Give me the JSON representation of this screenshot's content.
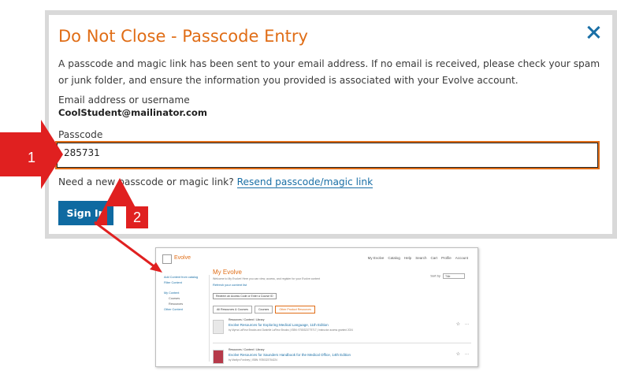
{
  "modal": {
    "title": "Do Not Close - Passcode Entry",
    "intro": "A passcode and magic link has been sent to your email address. If no email is received, please check your spam or junk folder, and ensure the information you provided is associated with your Evolve account.",
    "email_label": "Email address or username",
    "email_value": "CoolStudent@mailinator.com",
    "passcode_label": "Passcode",
    "passcode_value": "285731",
    "resend_prompt": "Need a new passcode or magic link?",
    "resend_link": "Resend passcode/magic link",
    "signin_label": "Sign In"
  },
  "callouts": {
    "one": "1",
    "two": "2"
  },
  "colors": {
    "accent": "#e06d16",
    "primary": "#0f6aa1",
    "callout": "#e02020"
  },
  "preview": {
    "logo": "Evolve",
    "topnav": [
      "My Evolve",
      "Catalog",
      "Help",
      "Search",
      "Cart",
      "Profile",
      "Account"
    ],
    "sidebar": [
      "Add Content from catalog",
      "Filter Content",
      "My Content",
      "Courses",
      "Resources",
      "Other Content"
    ],
    "title": "My Evolve",
    "subtitle": "Welcome to My Evolve! Here you can view, access, and register for your Evolve content",
    "refresh": "Refresh your content list",
    "redeem": "Redeem an Access Code or Enter a Course ID",
    "sort_label": "Sort by",
    "sort_value": "Title",
    "tabs": [
      "All Resources & Courses",
      "Courses",
      "Other Product Resources"
    ],
    "items": [
      {
        "category": "Resources / Content / Library",
        "name": "Evolve Resources for Exploring Medical Language, 11th Edition",
        "meta": "by Myrna LaFleur Brooks and Danielle LaFleur Brooks | ISBN: 9780323779717 | Instructor access granted 2024"
      },
      {
        "category": "Resources / Content / Library",
        "name": "Evolve Resources for Saunders Handbook for the Medical Office, 14th Edition",
        "meta": "by Marilyn Fordney | ISBN: 9780323754224"
      }
    ]
  }
}
